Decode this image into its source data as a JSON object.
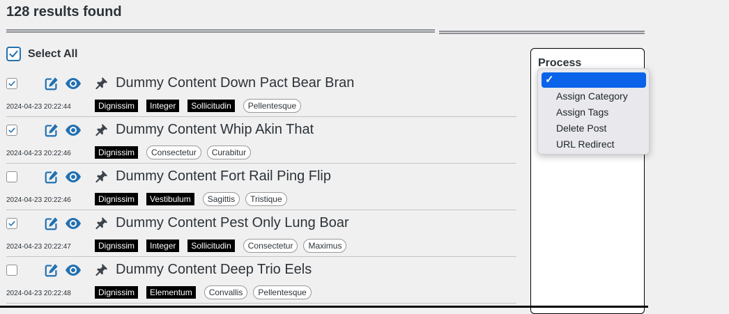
{
  "results": {
    "title": "128 results found"
  },
  "select_all": {
    "label": "Select All",
    "checked": true
  },
  "posts": [
    {
      "title": "Dummy Content Down Pact Bear Bran",
      "timestamp": "2024-04-23 20:22:44",
      "checked": true,
      "dark_tags": [
        "Dignissim",
        "Integer",
        "Sollicitudin"
      ],
      "light_tags": [
        "Pellentesque"
      ]
    },
    {
      "title": "Dummy Content Whip Akin That",
      "timestamp": "2024-04-23 20:22:46",
      "checked": true,
      "dark_tags": [
        "Dignissim"
      ],
      "light_tags": [
        "Consectetur",
        "Curabitur"
      ]
    },
    {
      "title": "Dummy Content Fort Rail Ping Flip",
      "timestamp": "2024-04-23 20:22:46",
      "checked": false,
      "dark_tags": [
        "Dignissim",
        "Vestibulum"
      ],
      "light_tags": [
        "Sagittis",
        "Tristique"
      ]
    },
    {
      "title": "Dummy Content Pest Only Lung Boar",
      "timestamp": "2024-04-23 20:22:47",
      "checked": true,
      "dark_tags": [
        "Dignissim",
        "Integer",
        "Sollicitudin"
      ],
      "light_tags": [
        "Consectetur",
        "Maximus"
      ]
    },
    {
      "title": "Dummy Content Deep Trio Eels",
      "timestamp": "2024-04-23 20:22:48",
      "checked": false,
      "dark_tags": [
        "Dignissim",
        "Elementum"
      ],
      "light_tags": [
        "Convallis",
        "Pellentesque"
      ]
    }
  ],
  "process": {
    "label": "Process",
    "options": [
      "",
      "Assign Category",
      "Assign Tags",
      "Delete Post",
      "URL Redirect"
    ],
    "selected_index": 0
  },
  "icons": {
    "edit": "edit-icon",
    "view": "eye-icon",
    "pin": "pin-icon",
    "check": "checkmark-icon"
  },
  "colors": {
    "accent": "#2271b1",
    "selected": "#0a63e8",
    "tag_dark": "#000000"
  }
}
